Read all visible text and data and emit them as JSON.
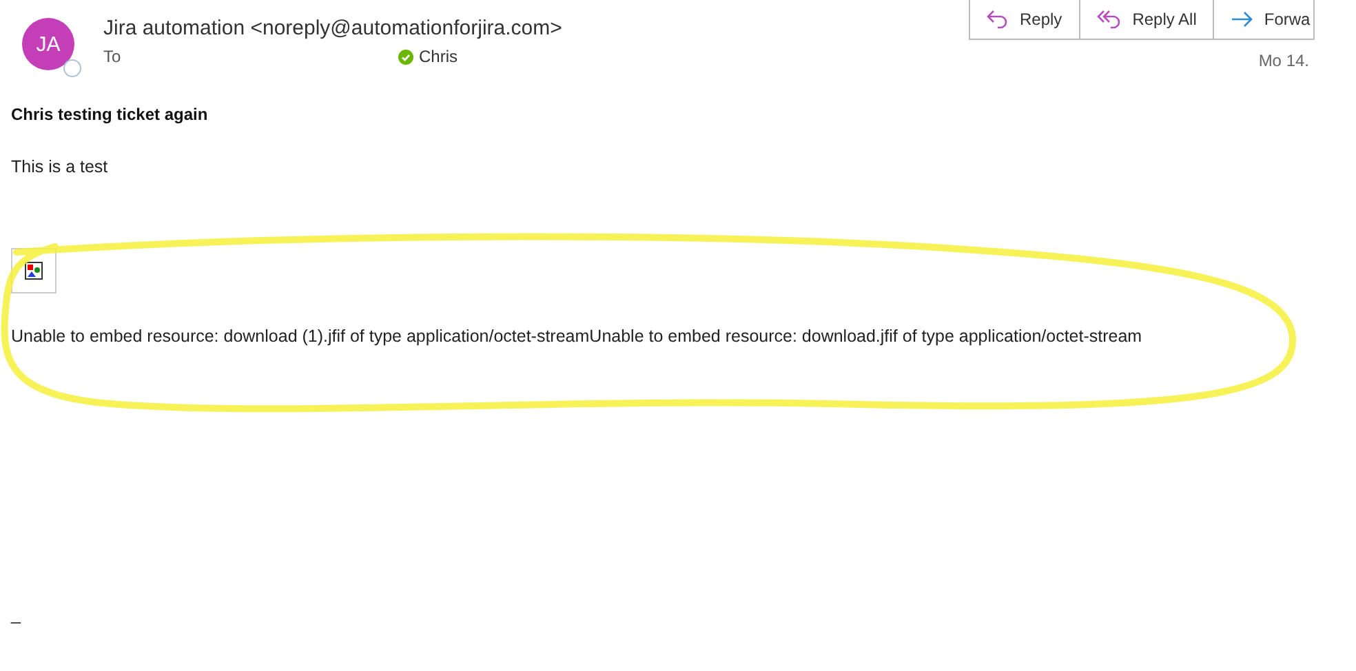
{
  "sender": {
    "initials": "JA",
    "name": "Jira automation <noreply@automationforjira.com>"
  },
  "recipients": {
    "label": "To",
    "name": "Chris"
  },
  "actions": [
    {
      "kind": "reply",
      "label": "Reply"
    },
    {
      "kind": "reply_all",
      "label": "Reply All"
    },
    {
      "kind": "forward",
      "label": "Forwa"
    }
  ],
  "date": "Mo 14.",
  "body": {
    "subject": "Chris testing ticket again",
    "text": "This is a test",
    "image": {
      "kind": "broken_image"
    },
    "error": "Unable to embed resource: download (1).jfif of type application/octet-streamUnable to embed resource: download.jfif of type application/octet-stream",
    "footer": "_"
  }
}
